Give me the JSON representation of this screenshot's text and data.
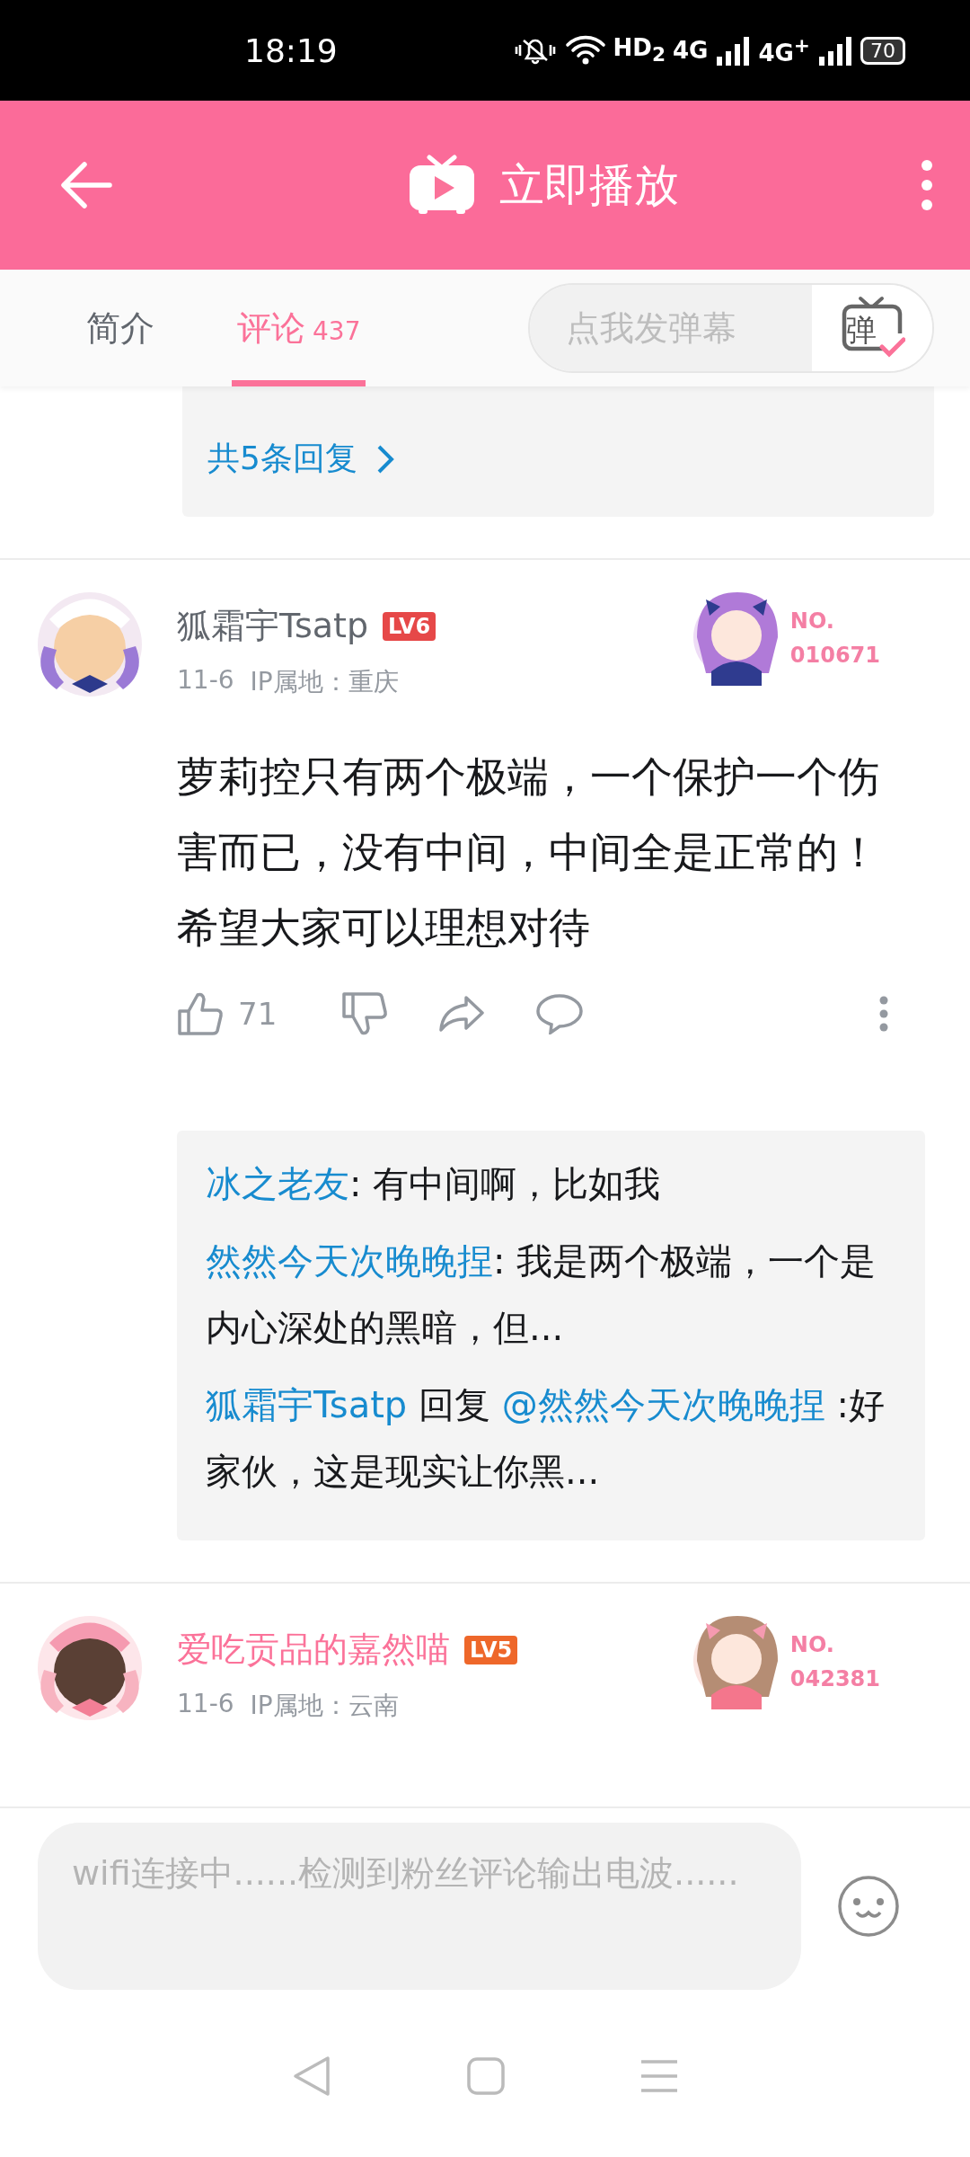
{
  "status_bar": {
    "time": "18:19",
    "network_labels": [
      "HD$_{2}$",
      "4G",
      "4G$^{+}$"
    ],
    "battery": "70"
  },
  "header": {
    "title": "立即播放"
  },
  "tabs": [
    {
      "label": "简介",
      "selected": false
    },
    {
      "label": "评论",
      "count": "437",
      "selected": true
    }
  ],
  "danmaku": {
    "placeholder": "点我发弹幕",
    "button_label": "弹"
  },
  "previous_replies": {
    "more_link": "共5条回复"
  },
  "comments": [
    {
      "user": "狐霜宇Tsatp",
      "vip": false,
      "level": {
        "label": "LV6",
        "color": "#e64848"
      },
      "fan_badge": {
        "prefix": "NO.",
        "number": "010671"
      },
      "date": "11-6",
      "location": "IP属地：重庆",
      "text": "萝莉控只有两个极端，一个保护一个伤害而已，没有中间，中间全是正常的！希望大家可以理想对待",
      "likes": "71",
      "replies": [
        {
          "user": "冰之老友",
          "text": ": 有中间啊，比如我"
        },
        {
          "user": "然然今天次晚晚捏",
          "text": ": 我是两个极端，一个是内心深处的黑暗，但..."
        },
        {
          "user": "狐霜宇Tsatp",
          "reply_word": "回复",
          "target": "@然然今天次晚晚捏",
          "text": " :好家伙，这是现实让你黑..."
        }
      ]
    },
    {
      "user": "爱吃贡品的嘉然喵",
      "vip": true,
      "level": {
        "label": "LV5",
        "color": "#ee672a"
      },
      "fan_badge": {
        "prefix": "NO.",
        "number": "042381"
      },
      "date": "11-6",
      "location": "IP属地：云南"
    }
  ],
  "comment_box": {
    "placeholder": "wifi连接中......检测到粉丝评论输出电波......"
  }
}
